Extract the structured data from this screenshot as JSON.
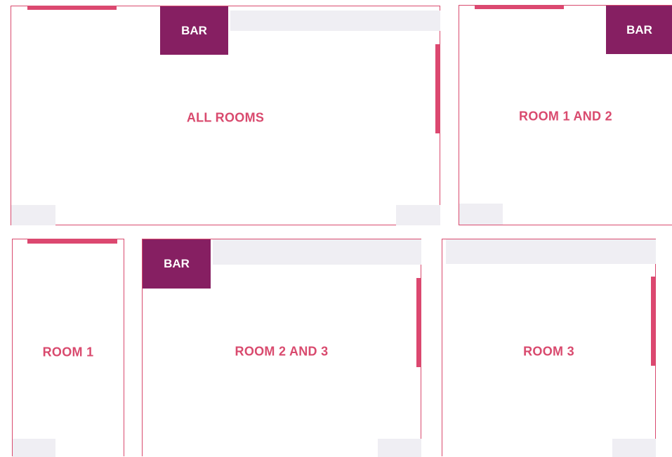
{
  "colors": {
    "accent": "#dc4870",
    "outline": "#d94a6e",
    "bar_fill": "#861f62",
    "bar_text": "#ffffff",
    "zone_fill": "#efeef3"
  },
  "bar_label": "BAR",
  "rooms": [
    {
      "id": "all-rooms",
      "label": "ALL ROOMS"
    },
    {
      "id": "room-1-and-2",
      "label": "ROOM 1 AND 2"
    },
    {
      "id": "room-1",
      "label": "ROOM 1"
    },
    {
      "id": "room-2-and-3",
      "label": "ROOM 2 AND 3"
    },
    {
      "id": "room-3",
      "label": "ROOM 3"
    }
  ]
}
